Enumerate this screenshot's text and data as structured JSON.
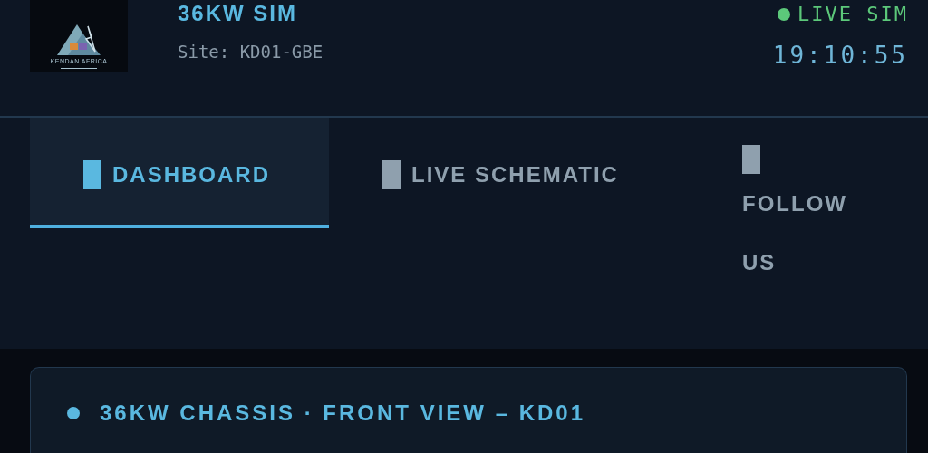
{
  "header": {
    "logo_text": "KENDAN AFRICA",
    "title": "36KW SIM",
    "site": "Site: KD01-GBE",
    "status": {
      "label": "LIVE SIM",
      "color": "#5cc87a"
    },
    "time": "19:10:55"
  },
  "tabs": [
    {
      "label": "DASHBOARD",
      "selected": true
    },
    {
      "label": "LIVE SCHEMATIC",
      "selected": false
    },
    {
      "label": "FOLLOW US",
      "selected": false
    }
  ],
  "card": {
    "title": "36KW CHASSIS · FRONT VIEW – KD01"
  }
}
